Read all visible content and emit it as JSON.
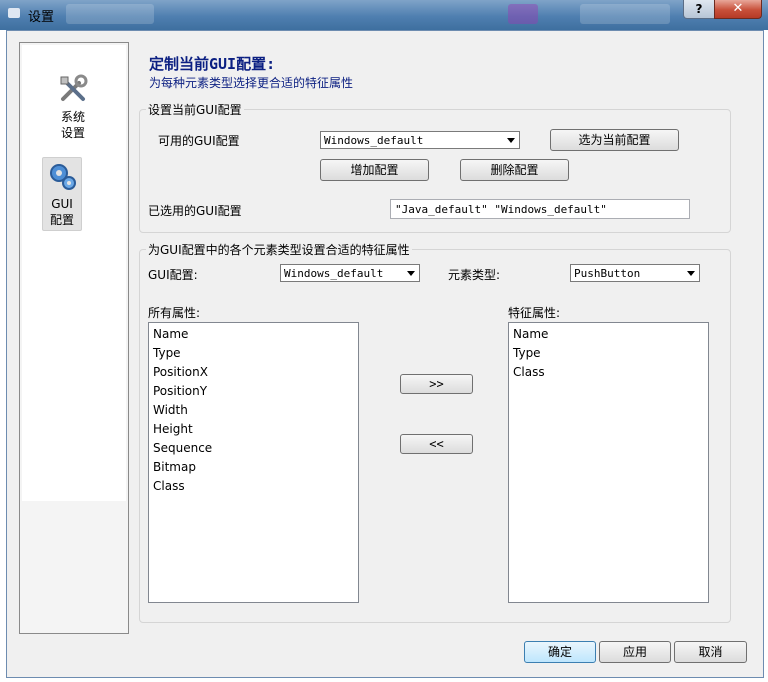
{
  "window": {
    "title": "设置",
    "help_label": "?",
    "close_label": "✕"
  },
  "sidebar": {
    "items": [
      {
        "label_line1": "系统",
        "label_line2": "设置",
        "icon": "tools-icon"
      },
      {
        "label_line1": "GUI",
        "label_line2": "配置",
        "icon": "gear-icon"
      }
    ]
  },
  "header": {
    "title": "定制当前GUI配置:",
    "subtitle": "为每种元素类型选择更合适的特征属性"
  },
  "current_config_group": {
    "title": "设置当前GUI配置",
    "available_label": "可用的GUI配置",
    "available_selected": "Windows_default",
    "set_current_button": "选为当前配置",
    "add_button": "增加配置",
    "delete_button": "删除配置",
    "selected_label": "已选用的GUI配置",
    "selected_value": "\"Java_default\" \"Windows_default\""
  },
  "attributes_group": {
    "title": "为GUI配置中的各个元素类型设置合适的特征属性",
    "gui_config_label": "GUI配置:",
    "gui_config_selected": "Windows_default",
    "element_type_label": "元素类型:",
    "element_type_selected": "PushButton",
    "all_attributes_label": "所有属性:",
    "all_attributes": [
      "Name",
      "Type",
      "PositionX",
      "PositionY",
      "Width",
      "Height",
      "Sequence",
      "Bitmap",
      "Class"
    ],
    "feature_attributes_label": "特征属性:",
    "feature_attributes": [
      "Name",
      "Type",
      "Class"
    ],
    "add_arrow": ">>",
    "remove_arrow": "<<"
  },
  "footer": {
    "ok": "确定",
    "apply": "应用",
    "cancel": "取消"
  }
}
